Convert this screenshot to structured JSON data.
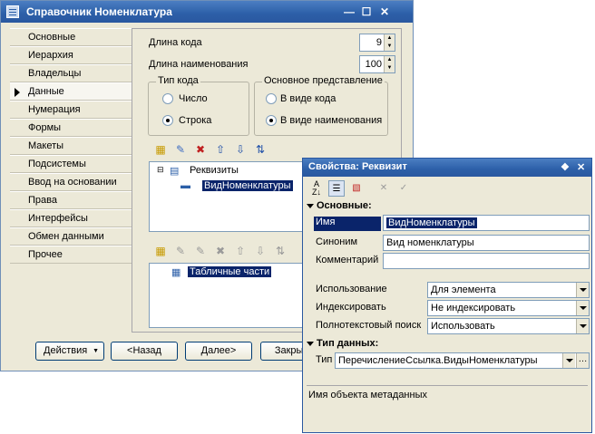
{
  "main_window": {
    "title": "Справочник Номенклатура",
    "title_buttons": [
      "minimize-icon",
      "maximize-icon",
      "close-icon"
    ]
  },
  "nav": {
    "items": [
      {
        "label": "Основные"
      },
      {
        "label": "Иерархия"
      },
      {
        "label": "Владельцы"
      },
      {
        "label": "Данные",
        "active": true
      },
      {
        "label": "Нумерация"
      },
      {
        "label": "Формы"
      },
      {
        "label": "Макеты"
      },
      {
        "label": "Подсистемы"
      },
      {
        "label": "Ввод на основании"
      },
      {
        "label": "Права"
      },
      {
        "label": "Интерфейсы"
      },
      {
        "label": "Обмен данными"
      },
      {
        "label": "Прочее"
      }
    ]
  },
  "data_tab": {
    "code_length_label": "Длина кода",
    "code_length_value": "9",
    "name_length_label": "Длина наименования",
    "name_length_value": "100",
    "code_type": {
      "legend": "Тип кода",
      "options": [
        "Число",
        "Строка"
      ],
      "selected": "Строка"
    },
    "main_presentation": {
      "legend": "Основное представление",
      "options": [
        "В виде кода",
        "В виде наименования"
      ],
      "selected": "В виде наименования"
    },
    "attributes_tree": {
      "root": "Реквизиты",
      "children": [
        "ВидНоменклатуры"
      ]
    },
    "tabular_tree": {
      "root": "Табличные части"
    }
  },
  "footer_buttons": {
    "actions": "Действия",
    "back": "<Назад",
    "next": "Далее>",
    "close": "Закрыть"
  },
  "properties_window": {
    "title": "Свойства: Реквизит",
    "section_main": "Основные:",
    "name_label": "Имя",
    "name_value": "ВидНоменклатуры",
    "synonym_label": "Синоним",
    "synonym_value": "Вид номенклатуры",
    "comment_label": "Комментарий",
    "comment_value": "",
    "usage_label": "Использование",
    "usage_value": "Для элемента",
    "index_label": "Индексировать",
    "index_value": "Не индексировать",
    "fulltext_label": "Полнотекстовый поиск",
    "fulltext_value": "Использовать",
    "section_datatype": "Тип данных:",
    "type_label": "Тип",
    "type_value": "ПеречислениеСсылка.ВидыНоменклатуры",
    "description": "Имя объекта метаданных"
  },
  "colors": {
    "titlebar": "#2c5fa8",
    "selection": "#0a246a",
    "window_bg": "#ece9d8"
  }
}
